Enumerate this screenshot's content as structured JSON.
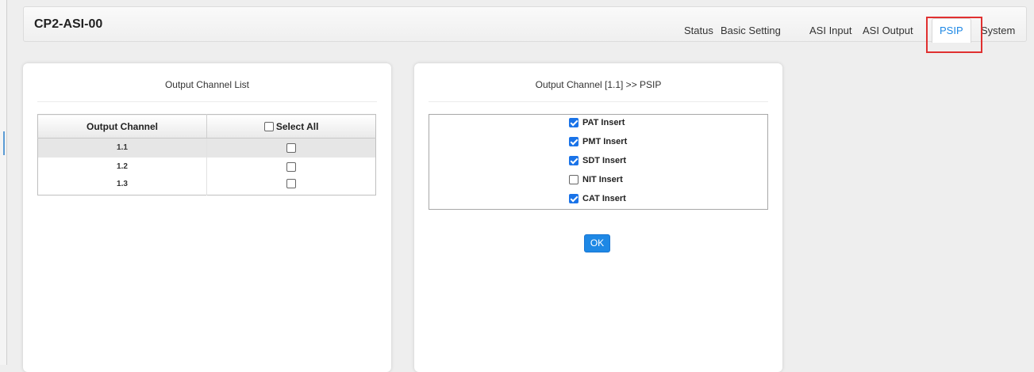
{
  "app": {
    "device_title": "CP2-ASI-00"
  },
  "nav": {
    "tabs": [
      {
        "label": "Status"
      },
      {
        "label": "Basic Setting"
      },
      {
        "label": "ASI Input"
      },
      {
        "label": "ASI Output"
      },
      {
        "label": "PSIP",
        "active": true
      },
      {
        "label": "System"
      }
    ]
  },
  "channel_list": {
    "title": "Output Channel List",
    "col_channel": "Output Channel",
    "col_select_all": "Select All",
    "select_all_checked": false,
    "rows": [
      {
        "channel": "1.1",
        "checked": false,
        "selected": true
      },
      {
        "channel": "1.2",
        "checked": false,
        "selected": false
      },
      {
        "channel": "1.3",
        "checked": false,
        "selected": false
      }
    ]
  },
  "psip": {
    "title": "Output Channel  [1.1] >> PSIP",
    "items": [
      {
        "label": "PAT Insert",
        "checked": true
      },
      {
        "label": "PMT Insert",
        "checked": true
      },
      {
        "label": "SDT Insert",
        "checked": true
      },
      {
        "label": "NIT Insert",
        "checked": false
      },
      {
        "label": "CAT Insert",
        "checked": true
      }
    ],
    "ok_label": "OK"
  },
  "colors": {
    "accent": "#1e88e5",
    "highlight": "#e03030"
  }
}
